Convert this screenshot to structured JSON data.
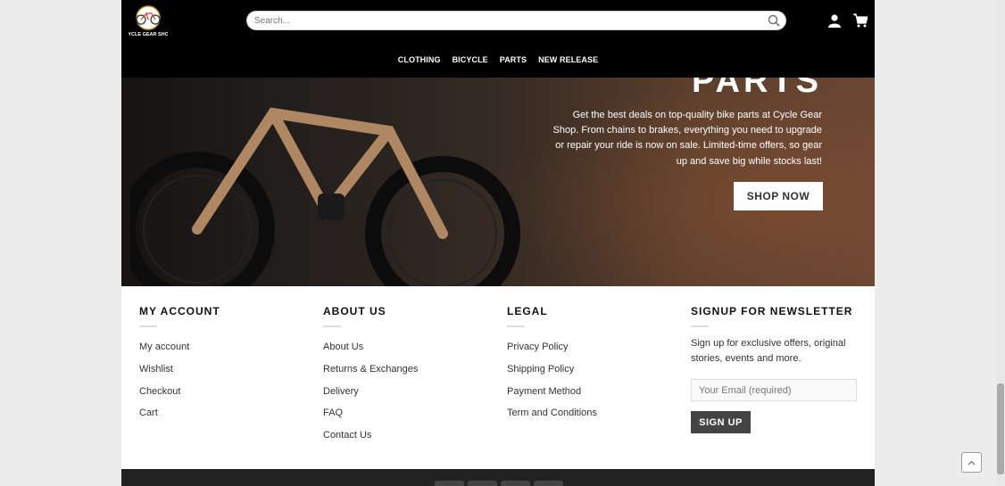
{
  "search": {
    "placeholder": "Search..."
  },
  "nav": [
    "CLOTHING",
    "BICYCLE",
    "PARTS",
    "NEW RELEASE"
  ],
  "hero": {
    "title": "PARTS",
    "description": "Get the best deals on top-quality bike parts at Cycle Gear Shop. From chains to brakes, everything you need to upgrade or repair your ride is now on sale. Limited-time offers, so gear up and save big while stocks last!",
    "button": "SHOP NOW"
  },
  "footer": {
    "account": {
      "title": "MY ACCOUNT",
      "links": [
        "My account",
        "Wishlist",
        "Checkout",
        "Cart"
      ]
    },
    "about": {
      "title": "ABOUT US",
      "links": [
        "About Us",
        "Returns & Exchanges",
        "Delivery",
        "FAQ",
        "Contact Us"
      ]
    },
    "legal": {
      "title": "LEGAL",
      "links": [
        "Privacy Policy",
        "Shipping Policy",
        "Payment Method",
        "Term and Conditions"
      ]
    },
    "newsletter": {
      "title": "SIGNUP FOR NEWSLETTER",
      "description": "Sign up for exclusive offers, original stories, events and more.",
      "email_placeholder": "Your Email (required)",
      "button": "SIGN UP"
    }
  },
  "colors": {
    "header_bg": "#000000",
    "footer_bg": "#ffffff",
    "button_dark": "#444444"
  }
}
